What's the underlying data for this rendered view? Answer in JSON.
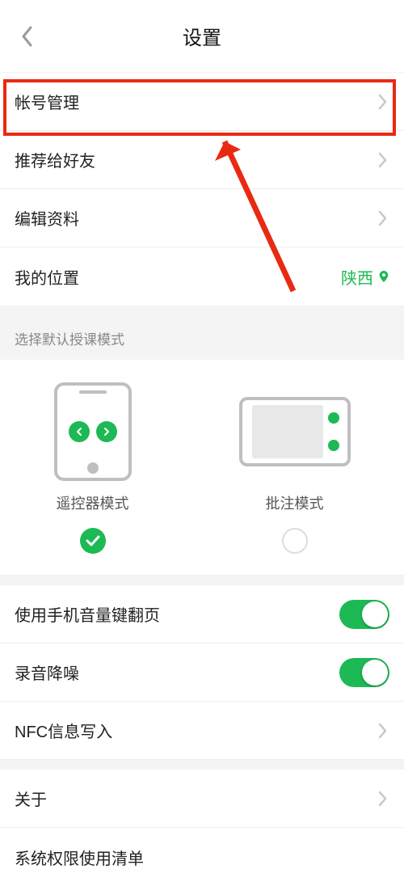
{
  "header": {
    "title": "设置"
  },
  "rows": {
    "account": "帐号管理",
    "recommend": "推荐给好友",
    "edit_profile": "编辑资料",
    "my_location_label": "我的位置",
    "my_location_value": "陕西"
  },
  "section_mode_label": "选择默认授课模式",
  "modes": {
    "remote": "遥控器模式",
    "annotate": "批注模式",
    "selected": "remote"
  },
  "toggles": {
    "volume_page": {
      "label": "使用手机音量键翻页",
      "on": true
    },
    "noise_reduce": {
      "label": "录音降噪",
      "on": true
    }
  },
  "rows2": {
    "nfc": "NFC信息写入",
    "about": "关于",
    "permissions": "系统权限使用清单"
  }
}
